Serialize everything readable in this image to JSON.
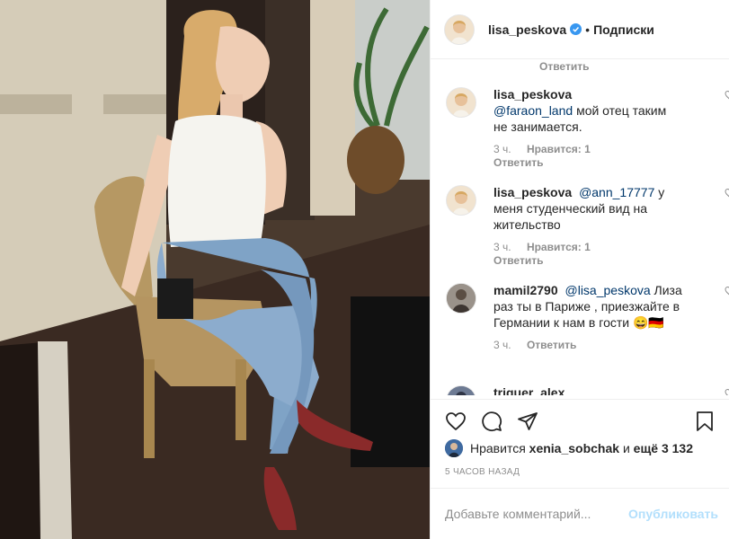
{
  "post": {
    "username": "lisa_peskova",
    "dot": "•",
    "follow_label": "Подписки"
  },
  "comments": {
    "top_reply_label": "Ответить",
    "items": [
      {
        "user": "lisa_peskova",
        "mention": "@faraon_land",
        "text": "мой отец таким не занимается.",
        "time": "3 ч.",
        "likes": "Нравится: 1",
        "reply": "Ответить"
      },
      {
        "user": "lisa_peskova",
        "mention": "@ann_17777",
        "text": "у меня студенческий вид на жительство",
        "time": "3 ч.",
        "likes": "Нравится: 1",
        "reply": "Ответить"
      },
      {
        "user": "mamil2790",
        "mention": "@lisa_peskova",
        "text": "Лиза раз ты в Париже , приезжайте в Германии к нам в гости 😄🇩🇪",
        "time": "3 ч.",
        "reply": "Ответить"
      },
      {
        "user": "triguer_alex"
      }
    ]
  },
  "likes": {
    "prefix": "Нравится",
    "user": "xenia_sobchak",
    "joiner": "и",
    "rest": "ещё 3 132"
  },
  "time_ago": "5 ЧАСОВ НАЗАД",
  "add_comment": {
    "placeholder": "Добавьте комментарий...",
    "publish": "Опубликовать"
  },
  "colors": {
    "verified": "#3897f0",
    "mention": "#00376b",
    "muted": "#8e8e8e",
    "publish_disabled": "#b2dffc"
  },
  "icons": {
    "verified": "verified-badge-icon",
    "heart": "heart-icon",
    "comment": "comment-bubble-icon",
    "share": "paper-plane-icon",
    "save": "bookmark-icon"
  }
}
